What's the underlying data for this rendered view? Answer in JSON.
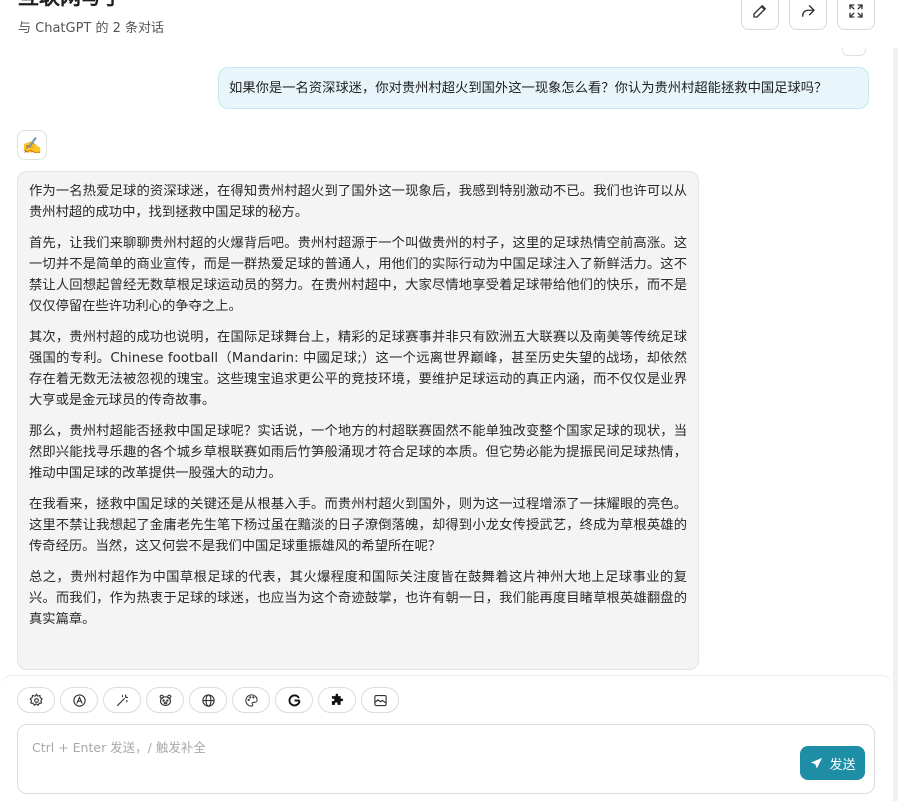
{
  "header": {
    "title": "互联网写手",
    "subtitle": "与 ChatGPT 的 2 条对话",
    "buttons": [
      {
        "name": "edit-button",
        "icon": "pencil-icon"
      },
      {
        "name": "share-button",
        "icon": "share-arrow-icon"
      },
      {
        "name": "fullscreen-button",
        "icon": "maximize-icon"
      }
    ]
  },
  "chat": {
    "user_message": "如果你是一名资深球迷，你对贵州村超火到国外这一现象怎么看？你认为贵州村超能拯救中国足球吗？",
    "bot_avatar": "✍️",
    "bot_paragraphs": [
      "作为一名热爱足球的资深球迷，在得知贵州村超火到了国外这一现象后，我感到特别激动不已。我们也许可以从贵州村超的成功中，找到拯救中国足球的秘方。",
      "首先，让我们来聊聊贵州村超的火爆背后吧。贵州村超源于一个叫做贵州的村子，这里的足球热情空前高涨。这一切并不是简单的商业宣传，而是一群热爱足球的普通人，用他们的实际行动为中国足球注入了新鲜活力。这不禁让人回想起曾经无数草根足球运动员的努力。在贵州村超中，大家尽情地享受着足球带给他们的快乐，而不是仅仅停留在些许功利心的争夺之上。",
      "其次，贵州村超的成功也说明，在国际足球舞台上，精彩的足球赛事并非只有欧洲五大联赛以及南美等传统足球强国的专利。Chinese football（Mandarin: 中國足球;）这一个远离世界巅峰，甚至历史失望的战场，却依然存在着无数无法被忽视的瑰宝。这些瑰宝追求更公平的竞技环境，要维护足球运动的真正内涵，而不仅仅是业界大亨或是金元球员的传奇故事。",
      "那么，贵州村超能否拯救中国足球呢？实话说，一个地方的村超联赛固然不能单独改变整个国家足球的现状，当然即兴能找寻乐趣的各个城乡草根联赛如雨后竹笋般涌现才符合足球的本质。但它势必能为提振民间足球热情，推动中国足球的改革提供一股强大的动力。",
      "在我看来，拯救中国足球的关键还是从根基入手。而贵州村超火到国外，则为这一过程增添了一抹耀眼的亮色。这里不禁让我想起了金庸老先生笔下杨过虽在黯淡的日子潦倒落魄，却得到小龙女传授武艺，终成为草根英雄的传奇经历。当然，这又何尝不是我们中国足球重振雄风的希望所在呢？",
      "总之，贵州村超作为中国草根足球的代表，其火爆程度和国际关注度皆在鼓舞着这片神州大地上足球事业的复兴。而我们，作为热衷于足球的球迷，也应当为这个奇迹鼓掌，也许有朝一日，我们能再度目睹草根英雄翻盘的真实篇章。"
    ]
  },
  "toolbar": {
    "tools": [
      {
        "name": "settings-tool",
        "icon": "gear-icon"
      },
      {
        "name": "prompt-tool",
        "icon": "robot-face-icon"
      },
      {
        "name": "magic-tool",
        "icon": "magic-wand-icon"
      },
      {
        "name": "mask-tool",
        "icon": "bear-face-icon"
      },
      {
        "name": "web-tool",
        "icon": "globe-icon"
      },
      {
        "name": "theme-tool",
        "icon": "palette-icon"
      },
      {
        "name": "google-tool",
        "icon": "google-g-icon"
      },
      {
        "name": "plugin-tool",
        "icon": "puzzle-icon"
      },
      {
        "name": "image-tool",
        "icon": "image-icon"
      }
    ]
  },
  "input": {
    "placeholder": "Ctrl + Enter 发送，/ 触发补全",
    "value": "",
    "send_label": "发送"
  },
  "colors": {
    "accent": "#1d8ea6",
    "user_bubble": "#e8f6fb",
    "bot_bubble": "#f4f4f4"
  }
}
